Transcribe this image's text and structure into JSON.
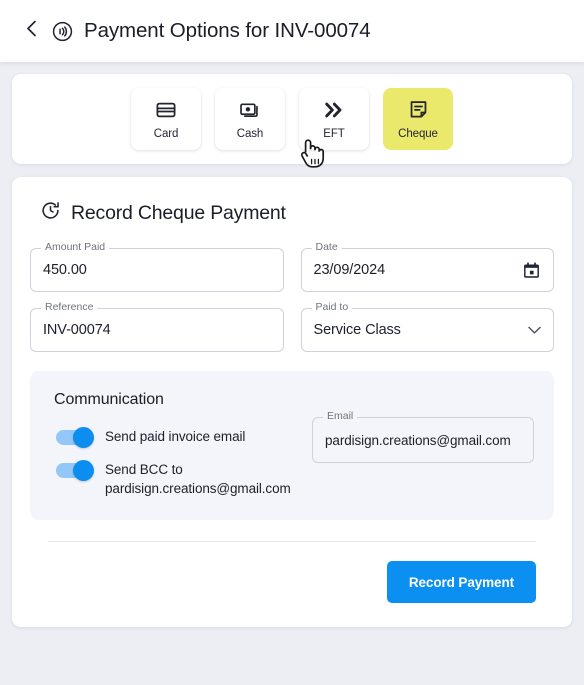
{
  "header": {
    "back_icon": "chevron-left-icon",
    "brand_icon": "contactless-payment-icon",
    "title": "Payment Options for INV-00074"
  },
  "payment_methods": {
    "selected": "Cheque",
    "items": [
      {
        "label": "Card",
        "icon": "credit-card-icon",
        "selected": false
      },
      {
        "label": "Cash",
        "icon": "banknotes-icon",
        "selected": false
      },
      {
        "label": "EFT",
        "icon": "double-chevron-right-icon",
        "selected": false
      },
      {
        "label": "Cheque",
        "icon": "note-document-icon",
        "selected": true
      }
    ],
    "selected_bg": "#ebe96b"
  },
  "cursor": {
    "icon": "pointing-hand-cursor"
  },
  "form": {
    "icon": "refresh-clock-icon",
    "title": "Record Cheque Payment",
    "fields": {
      "amount_paid": {
        "label": "Amount Paid",
        "value": "450.00"
      },
      "date": {
        "label": "Date",
        "value": "23/09/2024",
        "trailing_icon": "calendar-icon"
      },
      "reference": {
        "label": "Reference",
        "value": "INV-00074"
      },
      "paid_to": {
        "label": "Paid to",
        "value": "Service Class",
        "trailing_icon": "chevron-down-icon"
      }
    }
  },
  "communication": {
    "title": "Communication",
    "toggles": [
      {
        "label": "Send paid invoice email",
        "on": true
      },
      {
        "label": "Send BCC to pardisign.creations@gmail.com",
        "on": true
      }
    ],
    "email_field": {
      "label": "Email",
      "value": "pardisign.creations@gmail.com"
    }
  },
  "footer": {
    "submit_label": "Record Payment",
    "accent": "#0b90f1"
  }
}
